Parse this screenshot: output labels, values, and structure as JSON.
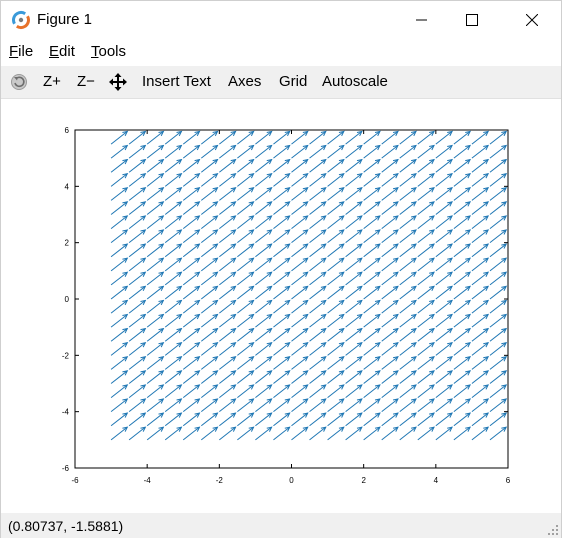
{
  "window": {
    "title": "Figure 1"
  },
  "menu": {
    "items": [
      {
        "label": "File",
        "underline_char": "F",
        "rest": "ile"
      },
      {
        "label": "Edit",
        "underline_char": "E",
        "rest": "dit"
      },
      {
        "label": "Tools",
        "underline_char": "T",
        "rest": "ools"
      }
    ]
  },
  "toolbar": {
    "rotate_icon": "rotate-icon",
    "zoom_in": "Z+",
    "zoom_out": "Z−",
    "pan_icon": "pan-icon",
    "insert_text": "Insert Text",
    "axes": "Axes",
    "grid": "Grid",
    "autoscale": "Autoscale"
  },
  "status": {
    "coordinates": "(0.80737, -1.5881)"
  },
  "colors": {
    "arrow": "#1f77b4",
    "toolbar_bg": "#f0f0f0"
  },
  "chart_data": {
    "type": "quiver",
    "title": "",
    "xlabel": "",
    "ylabel": "",
    "xlim": [
      -6,
      6
    ],
    "ylim": [
      -6,
      6
    ],
    "xticks": [
      -6,
      -4,
      -2,
      0,
      2,
      4,
      6
    ],
    "yticks": [
      -6,
      -4,
      -2,
      0,
      2,
      4,
      6
    ],
    "grid": false,
    "x_start": -5,
    "x_end": 5.5,
    "x_step": 0.5,
    "y_start": -5,
    "y_end": 5.5,
    "y_step": 0.5,
    "u": 1,
    "v": 1
  }
}
